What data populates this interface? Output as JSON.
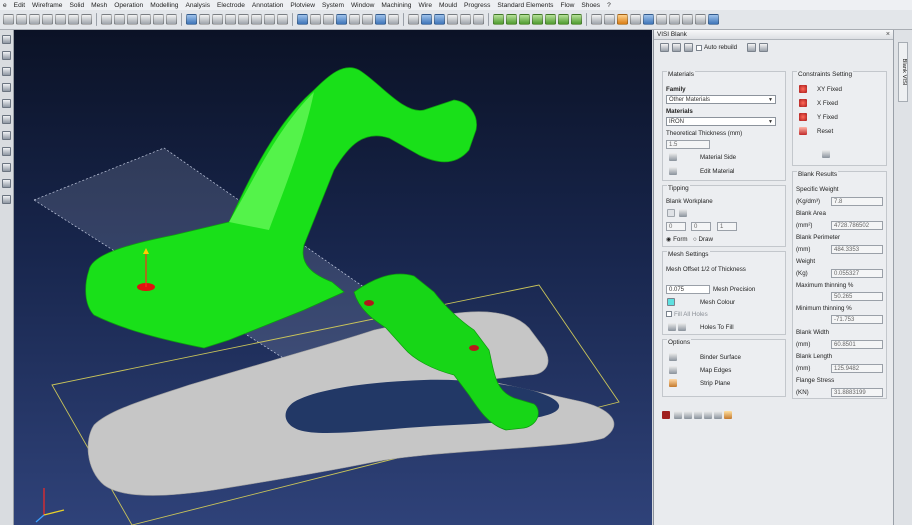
{
  "menu": [
    "e",
    "Edit",
    "Wireframe",
    "Solid",
    "Mesh",
    "Operation",
    "Modelling",
    "Analysis",
    "Electrode",
    "Annotation",
    "Plotview",
    "System",
    "Window",
    "Machining",
    "Wire",
    "Mould",
    "Progress",
    "Standard Elements",
    "Flow",
    "Shoes",
    "?"
  ],
  "panel": {
    "title": "VISI Blank",
    "close_icon": "×",
    "auto_rebuild_label": "Auto rebuild",
    "materials": {
      "title": "Materials",
      "family_label": "Family",
      "family_value": "Other Materials",
      "materials_label": "Materials",
      "materials_value": "IRON",
      "thickness_label": "Theoretical Thickness (mm)",
      "thickness_value": "1.5",
      "material_side_label": "Material Side",
      "edit_material_label": "Edit Material"
    },
    "constraints": {
      "title": "Constraints Setting",
      "items": [
        "XY Fixed",
        "X Fixed",
        "Y Fixed",
        "Reset"
      ]
    },
    "tipping": {
      "title": "Tipping",
      "workplane_label": "Blank Workplane",
      "values": [
        "0",
        "0",
        "1"
      ],
      "radio_form": "Form",
      "radio_draw": "Draw"
    },
    "mesh": {
      "title": "Mesh Settings",
      "offset_label": "Mesh Offset 1/2 of Thickness",
      "precision_value": "0.075",
      "precision_label": "Mesh Precision",
      "colour_label": "Mesh Colour",
      "fill_all_holes_label": "Fill All Holes",
      "holes_to_fill_label": "Holes To Fill",
      "colour_swatch": "#5ee0e0"
    },
    "options": {
      "title": "Options",
      "items": [
        "Binder Surface",
        "Map Edges",
        "Strip Plane"
      ]
    },
    "results": {
      "title": "Blank Results",
      "rows": [
        {
          "label": "Specific Weight",
          "unit": "(Kg/dm³)",
          "value": "7.8"
        },
        {
          "label": "Blank Area",
          "unit": "(mm²)",
          "value": "4728.786502"
        },
        {
          "label": "Blank Perimeter",
          "unit": "(mm)",
          "value": "484.3353"
        },
        {
          "label": "Weight",
          "unit": "(Kg)",
          "value": "0.055327"
        },
        {
          "label": "Maximum thinning %",
          "unit": "",
          "value": "50.265"
        },
        {
          "label": "Minimum thinning %",
          "unit": "",
          "value": "-71.753"
        },
        {
          "label": "Blank Width",
          "unit": "(mm)",
          "value": "60.8501"
        },
        {
          "label": "Blank Length",
          "unit": "(mm)",
          "value": "125.9482"
        },
        {
          "label": "Flange Stress",
          "unit": "(KN)",
          "value": "31.8883199"
        }
      ]
    }
  },
  "right_tab": "Blank VISI",
  "colors": {
    "part_green": "#19e019",
    "blank_gray": "#c8c8c8",
    "wire_yellow": "#c9c45a",
    "viewport_top": "#0b1226",
    "viewport_bottom": "#2f4279"
  }
}
